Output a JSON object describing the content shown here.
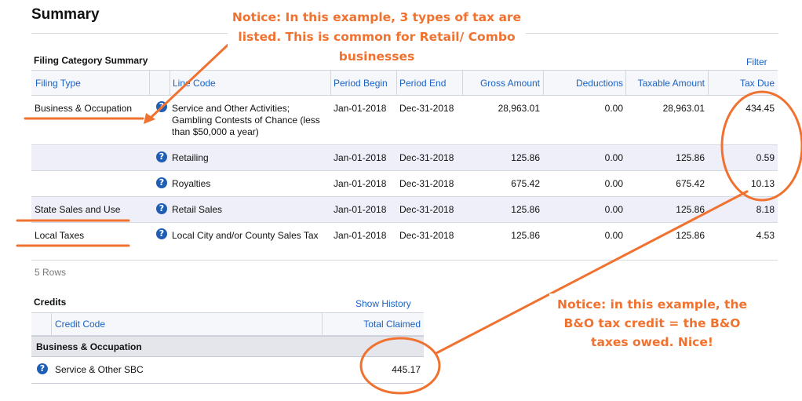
{
  "page": {
    "title": "Summary"
  },
  "filing_summary": {
    "title": "Filing Category Summary",
    "filter_label": "Filter",
    "columns": [
      "Filing Type",
      "Line Code",
      "Period Begin",
      "Period End",
      "Gross Amount",
      "Deductions",
      "Taxable Amount",
      "Tax Due"
    ],
    "rows": [
      {
        "filing_type": "Business & Occupation",
        "line_code": "Service and Other Activities; Gambling Contests of Chance (less than $50,000 a year)",
        "period_begin": "Jan-01-2018",
        "period_end": "Dec-31-2018",
        "gross": "28,963.01",
        "deductions": "0.00",
        "taxable": "28,963.01",
        "tax_due": "434.45"
      },
      {
        "filing_type": "",
        "line_code": "Retailing",
        "period_begin": "Jan-01-2018",
        "period_end": "Dec-31-2018",
        "gross": "125.86",
        "deductions": "0.00",
        "taxable": "125.86",
        "tax_due": "0.59"
      },
      {
        "filing_type": "",
        "line_code": "Royalties",
        "period_begin": "Jan-01-2018",
        "period_end": "Dec-31-2018",
        "gross": "675.42",
        "deductions": "0.00",
        "taxable": "675.42",
        "tax_due": "10.13"
      },
      {
        "filing_type": "State Sales and Use",
        "line_code": "Retail Sales",
        "period_begin": "Jan-01-2018",
        "period_end": "Dec-31-2018",
        "gross": "125.86",
        "deductions": "0.00",
        "taxable": "125.86",
        "tax_due": "8.18"
      },
      {
        "filing_type": "Local Taxes",
        "line_code": "Local City and/or County Sales Tax",
        "period_begin": "Jan-01-2018",
        "period_end": "Dec-31-2018",
        "gross": "125.86",
        "deductions": "0.00",
        "taxable": "125.86",
        "tax_due": "4.53"
      }
    ],
    "row_count": "5 Rows"
  },
  "credits": {
    "title": "Credits",
    "show_history_label": "Show History",
    "columns": [
      "Credit Code",
      "Total Claimed"
    ],
    "group": "Business & Occupation",
    "rows": [
      {
        "code": "Service & Other SBC",
        "total": "445.17"
      }
    ]
  },
  "annotations": {
    "note1": "Notice: In this example, 3 types of tax are listed. This is common for Retail/ Combo businesses",
    "note2": "Notice: in this example, the B&O tax credit = the B&O taxes owed. Nice!"
  },
  "icons": {
    "help": "question-circle-icon"
  },
  "colors": {
    "accent_link": "#1a62c4",
    "annotation": "#f07230",
    "help_icon": "#1e5eb5",
    "alt_row": "#eeeff8"
  }
}
